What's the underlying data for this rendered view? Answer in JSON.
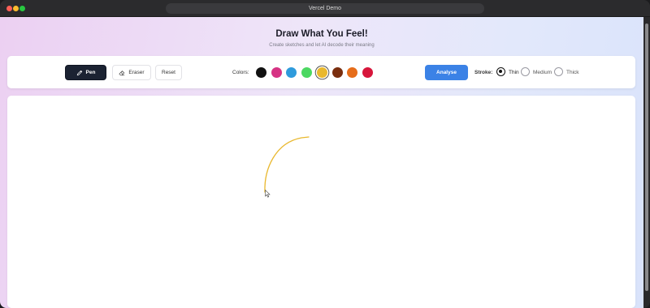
{
  "window": {
    "title": "Vercel Demo"
  },
  "header": {
    "title": "Draw What You Feel!",
    "subtitle": "Create sketches and let AI decode their meaning"
  },
  "toolbar": {
    "tools": [
      {
        "label": "Pen",
        "icon": "pencil-icon",
        "active": true
      },
      {
        "label": "Eraser",
        "icon": "eraser-icon",
        "active": false
      },
      {
        "label": "Reset",
        "active": false
      }
    ],
    "colors_label": "Colors:",
    "colors": [
      "#111111",
      "#d63384",
      "#2f9bdc",
      "#4cd862",
      "#e9b82e",
      "#7a2e0e",
      "#e66d1a",
      "#d7163b"
    ],
    "selected_color_index": 4,
    "analyse_label": "Analyse",
    "stroke_label": "Stroke:",
    "stroke_options": [
      "Thin",
      "Medium",
      "Thick"
    ],
    "selected_stroke": "Thin"
  },
  "canvas": {
    "stroke_color": "#e9b82e"
  }
}
